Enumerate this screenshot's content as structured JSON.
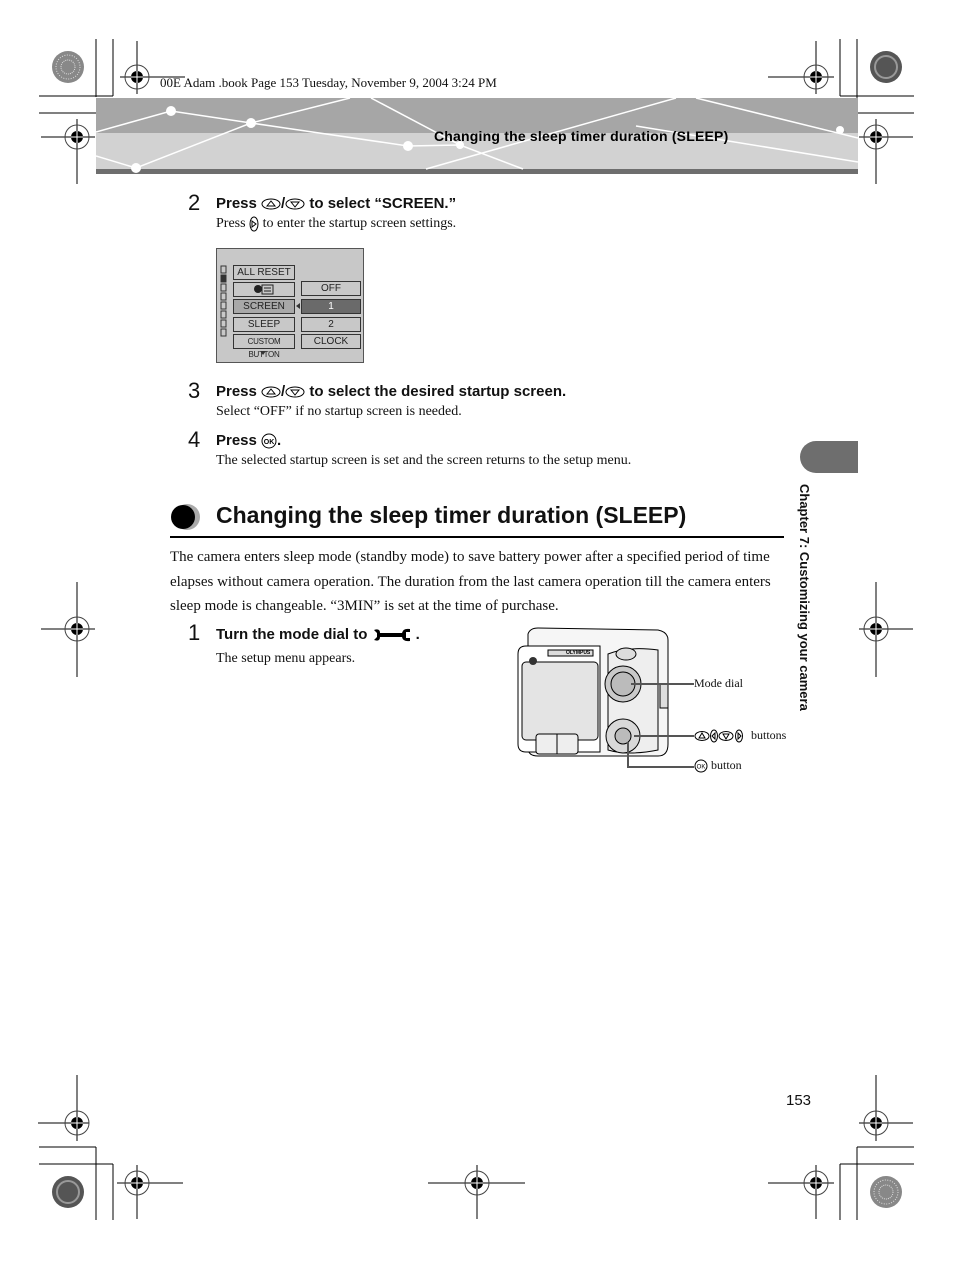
{
  "slug": "00E Adam .book  Page 153  Tuesday, November 9, 2004  3:24 PM",
  "header": {
    "title": "Changing the sleep timer duration (SLEEP)"
  },
  "steps_top": [
    {
      "number": "2",
      "title_pre": "Press ",
      "title_post": " to select “SCREEN.”",
      "body_pre": "Press ",
      "body_post": " to enter the startup screen settings.",
      "icons": [
        "up-button-icon",
        "down-button-icon",
        "right-button-icon"
      ]
    },
    {
      "number": "3",
      "title_pre": "Press ",
      "title_post": " to select the desired startup screen.",
      "body": "Select “OFF” if no startup screen is needed.",
      "icons": [
        "up-button-icon",
        "down-button-icon"
      ]
    },
    {
      "number": "4",
      "title_pre": "Press ",
      "title_post": ".",
      "body": "The selected startup screen is set and the screen returns to the setup menu.",
      "icons": [
        "ok-button-icon"
      ]
    }
  ],
  "lcd_menu": {
    "left_items": [
      "ALL RESET",
      "",
      "SCREEN",
      "SLEEP",
      "CUSTOM BUTTON"
    ],
    "left_selected": "SCREEN",
    "right_items": [
      "OFF",
      "1",
      "2",
      "CLOCK"
    ],
    "right_selected": "1"
  },
  "section": {
    "title": "Changing the sleep timer duration (SLEEP)",
    "paragraph": "The camera enters sleep mode (standby mode) to save battery power after a specified period of time elapses without camera operation. The duration from the last camera operation till the camera enters sleep mode is changeable. “3MIN” is set at the time of purchase."
  },
  "step1": {
    "number": "1",
    "title_pre": "Turn the mode dial to ",
    "title_post": ".",
    "icon": "wrench-icon",
    "body": "The setup menu appears."
  },
  "camera_callouts": {
    "mode_dial": "Mode dial",
    "arrow_buttons": "buttons",
    "ok_button": "button",
    "brand": "OLYMPUS"
  },
  "side_tab": {
    "label": "Chapter 7: Customizing your camera"
  },
  "page_number": "153"
}
